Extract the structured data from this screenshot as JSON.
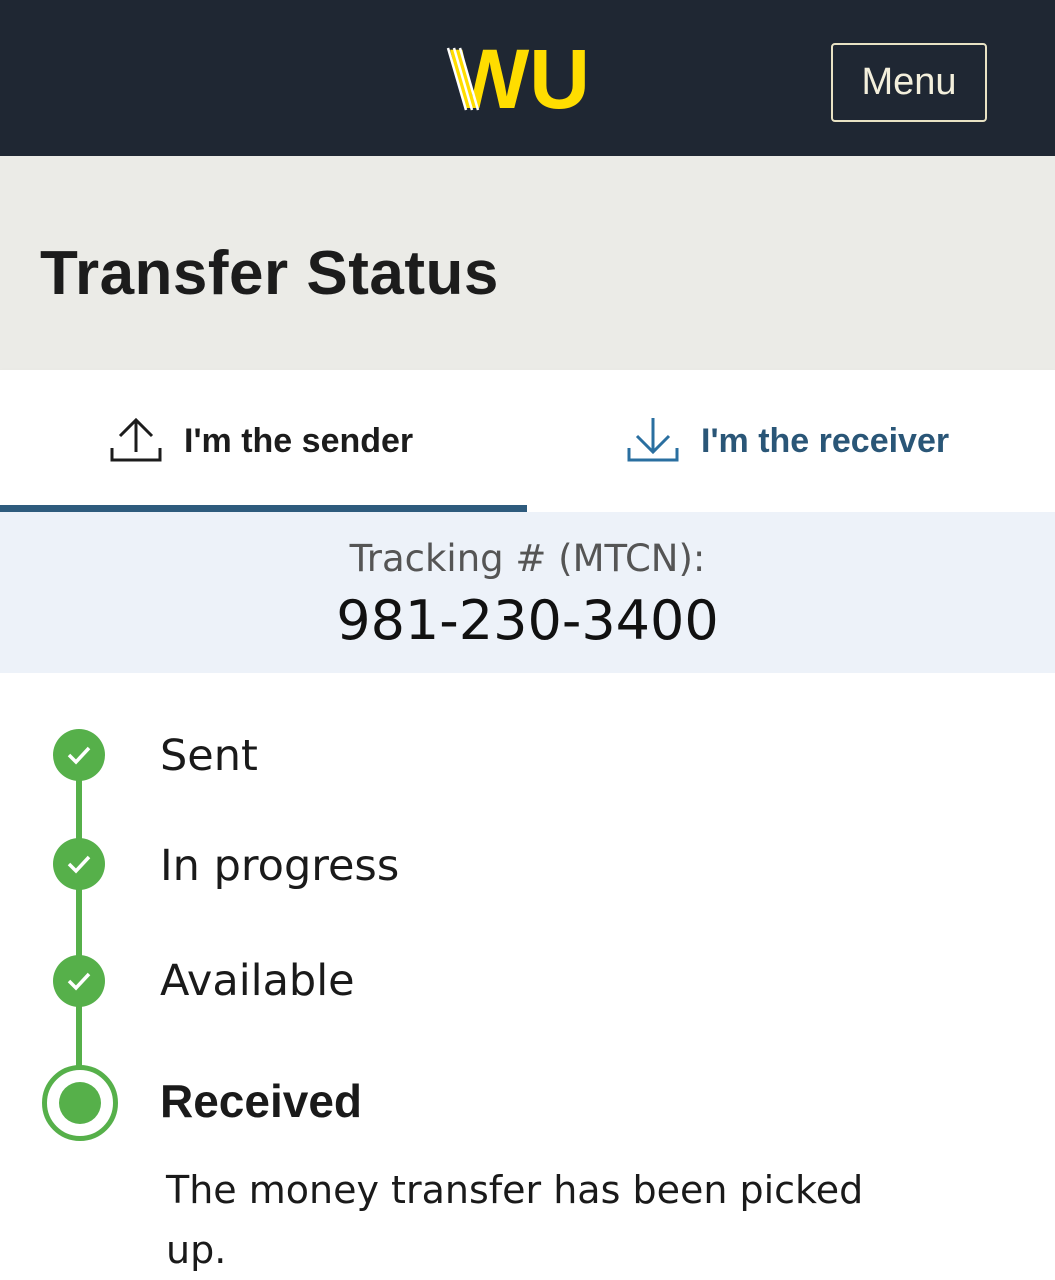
{
  "header": {
    "logo_text": "WU",
    "menu_label": "Menu"
  },
  "page": {
    "title": "Transfer Status"
  },
  "tabs": [
    {
      "label": "I'm the sender",
      "icon": "upload-icon",
      "active": true
    },
    {
      "label": "I'm the receiver",
      "icon": "download-icon",
      "active": false
    }
  ],
  "tracking": {
    "label": "Tracking # (MTCN):",
    "number": "981-230-3400"
  },
  "steps": [
    {
      "label": "Sent",
      "state": "complete",
      "icon": "check-icon"
    },
    {
      "label": "In progress",
      "state": "complete",
      "icon": "check-icon"
    },
    {
      "label": "Available",
      "state": "complete",
      "icon": "check-icon"
    },
    {
      "label": "Received",
      "state": "current",
      "description": "The money transfer has been picked up."
    }
  ],
  "colors": {
    "header_bg": "#1f2733",
    "brand_yellow": "#ffdd00",
    "title_band": "#ebebe7",
    "tab_active": "#2e5b7d",
    "tracking_bg": "#edf2f9",
    "success_green": "#56b04a"
  }
}
